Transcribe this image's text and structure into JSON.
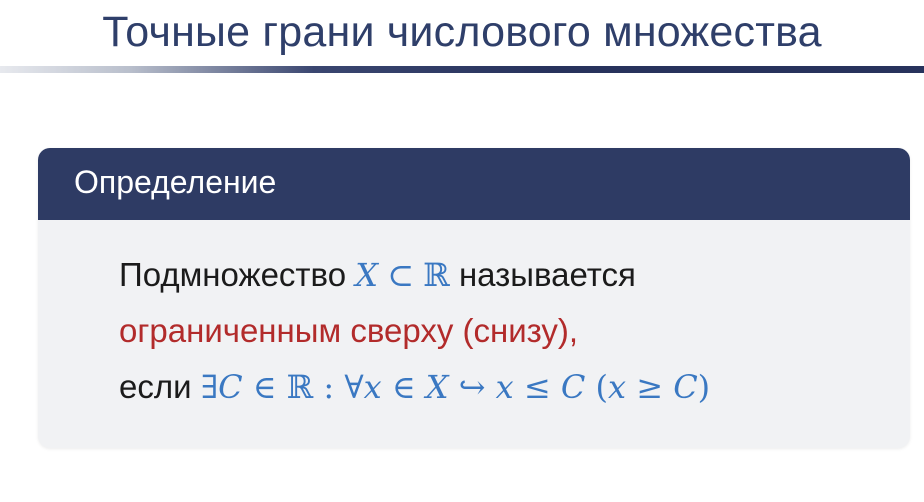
{
  "slide": {
    "title": "Точные грани числового множества"
  },
  "definition": {
    "header": "Определение",
    "line1": {
      "before": "Подмножество",
      "math_set": "X",
      "math_subset": "⊂",
      "math_reals": "ℝ",
      "after": "называется"
    },
    "line2": {
      "emphasis": "ограниченным сверху (снизу),"
    },
    "line3": {
      "before": "если",
      "exists": "∃",
      "var_c": "C",
      "in1": "∈",
      "reals": "ℝ",
      "colon": ":",
      "forall": "∀",
      "var_x": "x",
      "in2": "∈",
      "var_X": "X",
      "arrow": "↪",
      "var_x2": "x",
      "leq": "≤",
      "var_c2": "C",
      "paren_open": "(",
      "var_x3": "x",
      "geq": "≥",
      "var_c3": "C",
      "paren_close": ")"
    }
  },
  "colors": {
    "title": "#2f3f6a",
    "header_bg": "#2e3b64",
    "block_bg": "#f1f2f4",
    "emphasis": "#b22b2b",
    "math": "#3a78c2"
  }
}
